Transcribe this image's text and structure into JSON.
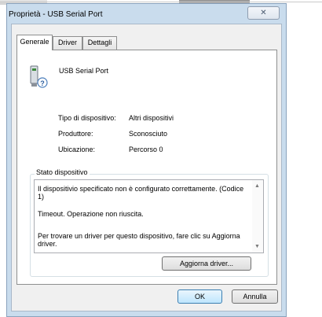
{
  "window": {
    "title": "Proprietà - USB Serial Port",
    "close_label": "✕"
  },
  "tabs": [
    {
      "label": "Generale",
      "active": true
    },
    {
      "label": "Driver",
      "active": false
    },
    {
      "label": "Dettagli",
      "active": false
    }
  ],
  "device": {
    "name": "USB Serial Port",
    "icon": "usb-device-warning-icon",
    "properties": [
      {
        "label": "Tipo di dispositivo:",
        "value": "Altri dispositivi"
      },
      {
        "label": "Produttore:",
        "value": "Sconosciuto"
      },
      {
        "label": "Ubicazione:",
        "value": "Percorso 0"
      }
    ]
  },
  "status": {
    "group_label": "Stato dispositivo",
    "lines": [
      "Il dispositivio specificato non è configurato correttamente. (Codice 1)",
      "Timeout. Operazione non riuscita.",
      "Per trovare un driver per questo dispositivo, fare clic su Aggiorna driver."
    ]
  },
  "buttons": {
    "update_driver": "Aggiorna driver...",
    "ok": "OK",
    "cancel": "Annulla"
  }
}
